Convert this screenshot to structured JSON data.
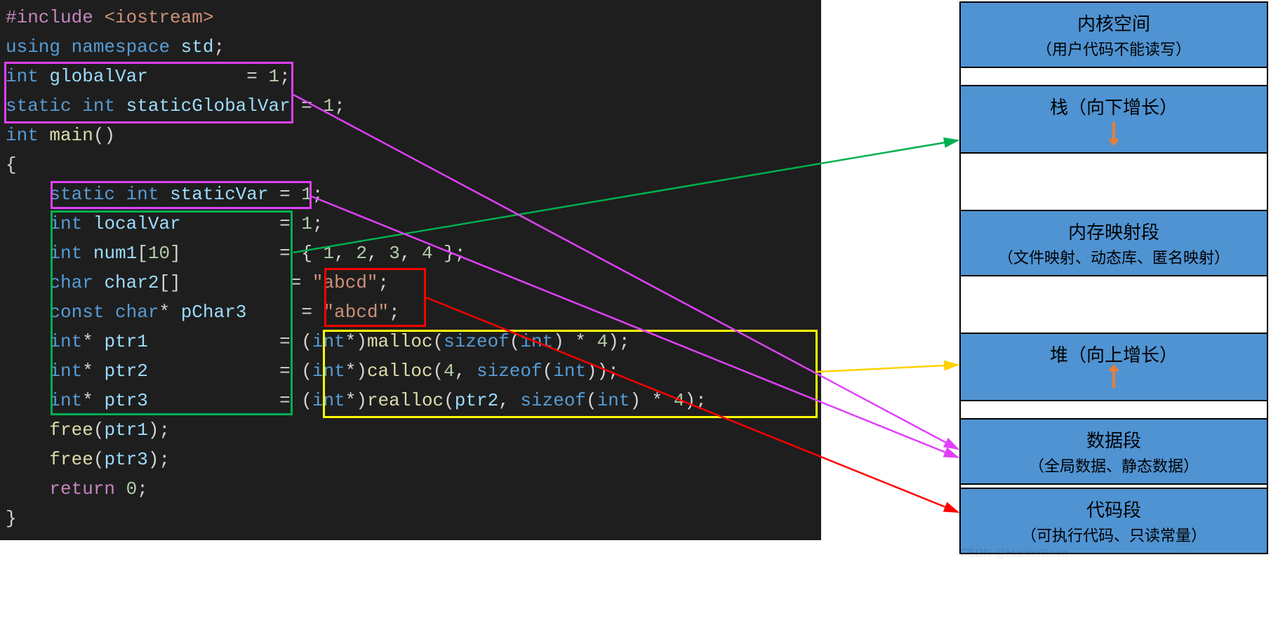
{
  "code": {
    "l1_inc": "#include ",
    "l1_hdr": "<iostream>",
    "l2a": "using ",
    "l2b": "namespace ",
    "l2c": "std",
    "l2d": ";",
    "l3a": "int ",
    "l3b": "globalVar         ",
    "l3c": "= ",
    "l3d": "1",
    "l3e": ";",
    "l4a": "static ",
    "l4b": "int ",
    "l4c": "staticGlobalVar ",
    "l4d": "= ",
    "l4e": "1",
    "l4f": ";",
    "l5a": "int ",
    "l5b": "main",
    "l5c": "()",
    "l6": "{",
    "l7a": "    ",
    "l7b": "static ",
    "l7c": "int ",
    "l7d": "staticVar ",
    "l7e": "= ",
    "l7f": "1",
    "l7g": ";",
    "l8a": "    ",
    "l8b": "int ",
    "l8c": "localVar         ",
    "l8d": "= ",
    "l8e": "1",
    "l8f": ";",
    "l9a": "    ",
    "l9b": "int ",
    "l9c": "num1",
    "l9d": "[",
    "l9e": "10",
    "l9f": "]         ",
    "l9g": "= { ",
    "l9h": "1",
    "l9i": ", ",
    "l9j": "2",
    "l9k": ", ",
    "l9l": "3",
    "l9m": ", ",
    "l9n": "4",
    "l9o": " };",
    "l10a": "    ",
    "l10b": "char ",
    "l10c": "char2",
    "l10d": "[]          ",
    "l10e": "= ",
    "l10f": "\"abcd\"",
    "l10g": ";",
    "l11a": "    ",
    "l11b": "const ",
    "l11c": "char",
    "l11d": "* ",
    "l11e": "pChar3     ",
    "l11f": "= ",
    "l11g": "\"abcd\"",
    "l11h": ";",
    "l12a": "    ",
    "l12b": "int",
    "l12c": "* ",
    "l12d": "ptr1            ",
    "l12e": "= (",
    "l12f": "int",
    "l12g": "*)",
    "l12h": "malloc",
    "l12i": "(",
    "l12j": "sizeof",
    "l12k": "(",
    "l12l": "int",
    "l12m": ") * ",
    "l12n": "4",
    "l12o": ");",
    "l13a": "    ",
    "l13b": "int",
    "l13c": "* ",
    "l13d": "ptr2            ",
    "l13e": "= (",
    "l13f": "int",
    "l13g": "*)",
    "l13h": "calloc",
    "l13i": "(",
    "l13j": "4",
    "l13k": ", ",
    "l13l": "sizeof",
    "l13m": "(",
    "l13n": "int",
    "l13o": "));",
    "l14a": "    ",
    "l14b": "int",
    "l14c": "* ",
    "l14d": "ptr3            ",
    "l14e": "= (",
    "l14f": "int",
    "l14g": "*)",
    "l14h": "realloc",
    "l14i": "(",
    "l14j": "ptr2",
    "l14k": ", ",
    "l14l": "sizeof",
    "l14m": "(",
    "l14n": "int",
    "l14o": ") * ",
    "l14p": "4",
    "l14q": ");",
    "l15a": "    ",
    "l15b": "free",
    "l15c": "(",
    "l15d": "ptr1",
    "l15e": ");",
    "l16a": "    ",
    "l16b": "free",
    "l16c": "(",
    "l16d": "ptr3",
    "l16e": ");",
    "l17a": "    ",
    "l17b": "return ",
    "l17c": "0",
    "l17d": ";",
    "l19": "}"
  },
  "mem": {
    "kernel_t": "内核空间",
    "kernel_s": "（用户代码不能读写）",
    "stack_t": "栈（向下增长）",
    "mmap_t": "内存映射段",
    "mmap_s": "（文件映射、动态库、匿名映射）",
    "heap_t": "堆（向上增长）",
    "data_t": "数据段",
    "data_s": "（全局数据、静态数据）",
    "code_t": "代码段",
    "code_s": "（可执行代码、只读常量）"
  },
  "watermark": "CSDN @HackerKevn"
}
